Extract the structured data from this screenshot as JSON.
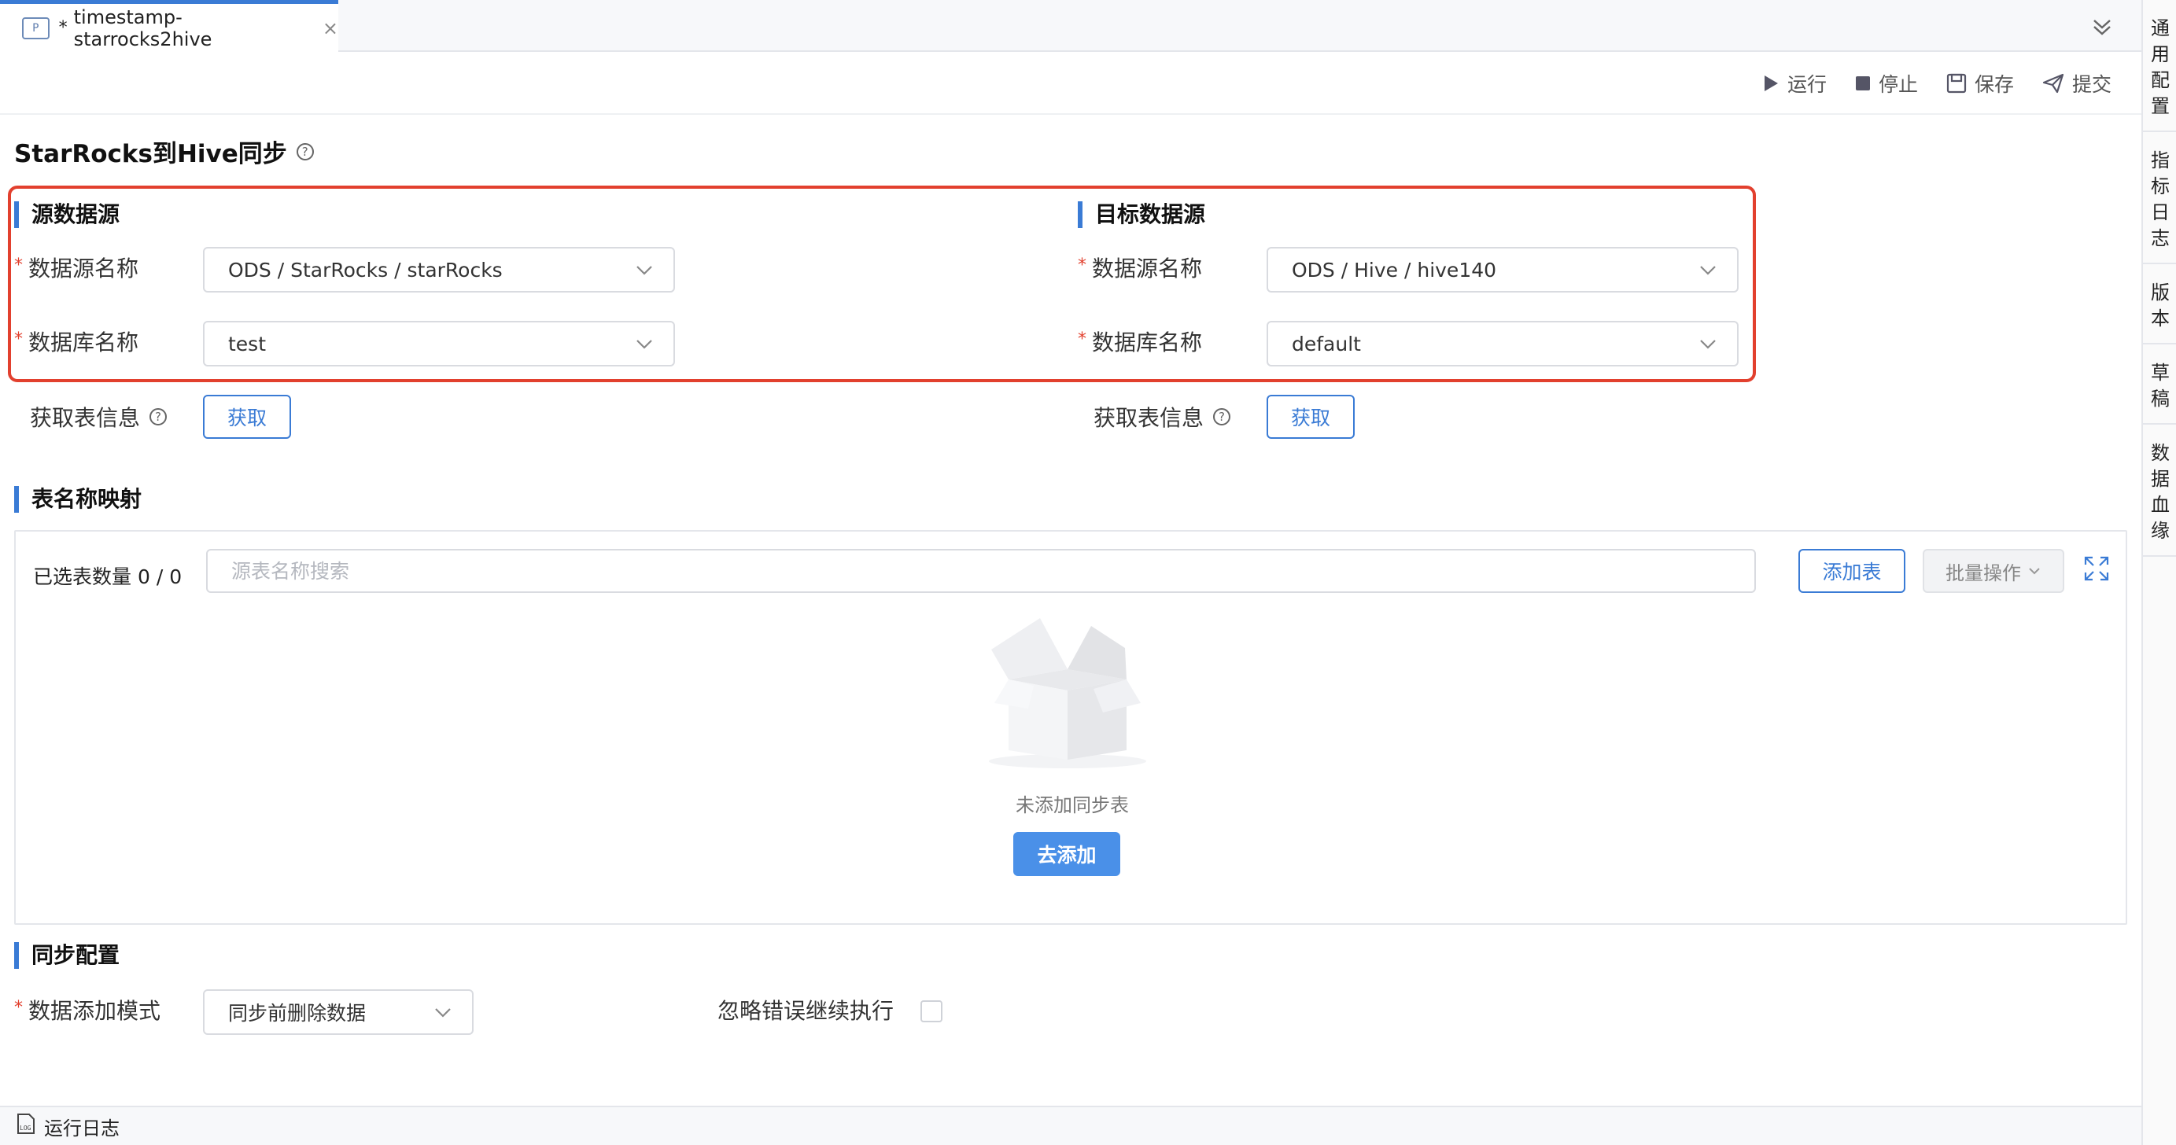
{
  "tab": {
    "icon_text": "P",
    "dirty_mark": "*",
    "title": "timestamp-starrocks2hive",
    "close_glyph": "×",
    "collapse_glyph": "≫"
  },
  "right_sidebar": {
    "items": [
      {
        "chars": [
          "通",
          "用",
          "配",
          "置"
        ]
      },
      {
        "chars": [
          "指",
          "标",
          "日",
          "志"
        ]
      },
      {
        "chars": [
          "版",
          "本"
        ]
      },
      {
        "chars": [
          "草",
          "稿"
        ]
      },
      {
        "chars": [
          "数",
          "据",
          "血",
          "缘"
        ]
      }
    ]
  },
  "toolbar": {
    "run": "运行",
    "stop": "停止",
    "save": "保存",
    "submit": "提交"
  },
  "page": {
    "title": "StarRocks到Hive同步",
    "help": "?"
  },
  "source": {
    "heading": "源数据源",
    "required_mark": "*",
    "ds_label": "数据源名称",
    "ds_value": "ODS / StarRocks / starRocks",
    "db_label": "数据库名称",
    "db_value": "test",
    "fetch_label": "获取表信息",
    "fetch_button": "获取"
  },
  "target": {
    "heading": "目标数据源",
    "required_mark": "*",
    "ds_label": "数据源名称",
    "ds_value": "ODS / Hive / hive140",
    "db_label": "数据库名称",
    "db_value": "default",
    "fetch_label": "获取表信息",
    "fetch_button": "获取"
  },
  "mapping": {
    "heading": "表名称映射",
    "selected_label": "已选表数量",
    "selected_count": "0 / 0",
    "search_placeholder": "源表名称搜索",
    "add_table": "添加表",
    "batch": "批量操作",
    "empty_text": "未添加同步表",
    "go_add": "去添加"
  },
  "sync": {
    "heading": "同步配置",
    "required_mark": "*",
    "mode_label": "数据添加模式",
    "mode_value": "同步前删除数据",
    "ignore_label": "忽略错误继续执行"
  },
  "bottom": {
    "log_label": "运行日志"
  },
  "colors": {
    "accent": "#3a7bd5",
    "highlight": "#e2402e",
    "primary_button": "#4a90e8"
  }
}
